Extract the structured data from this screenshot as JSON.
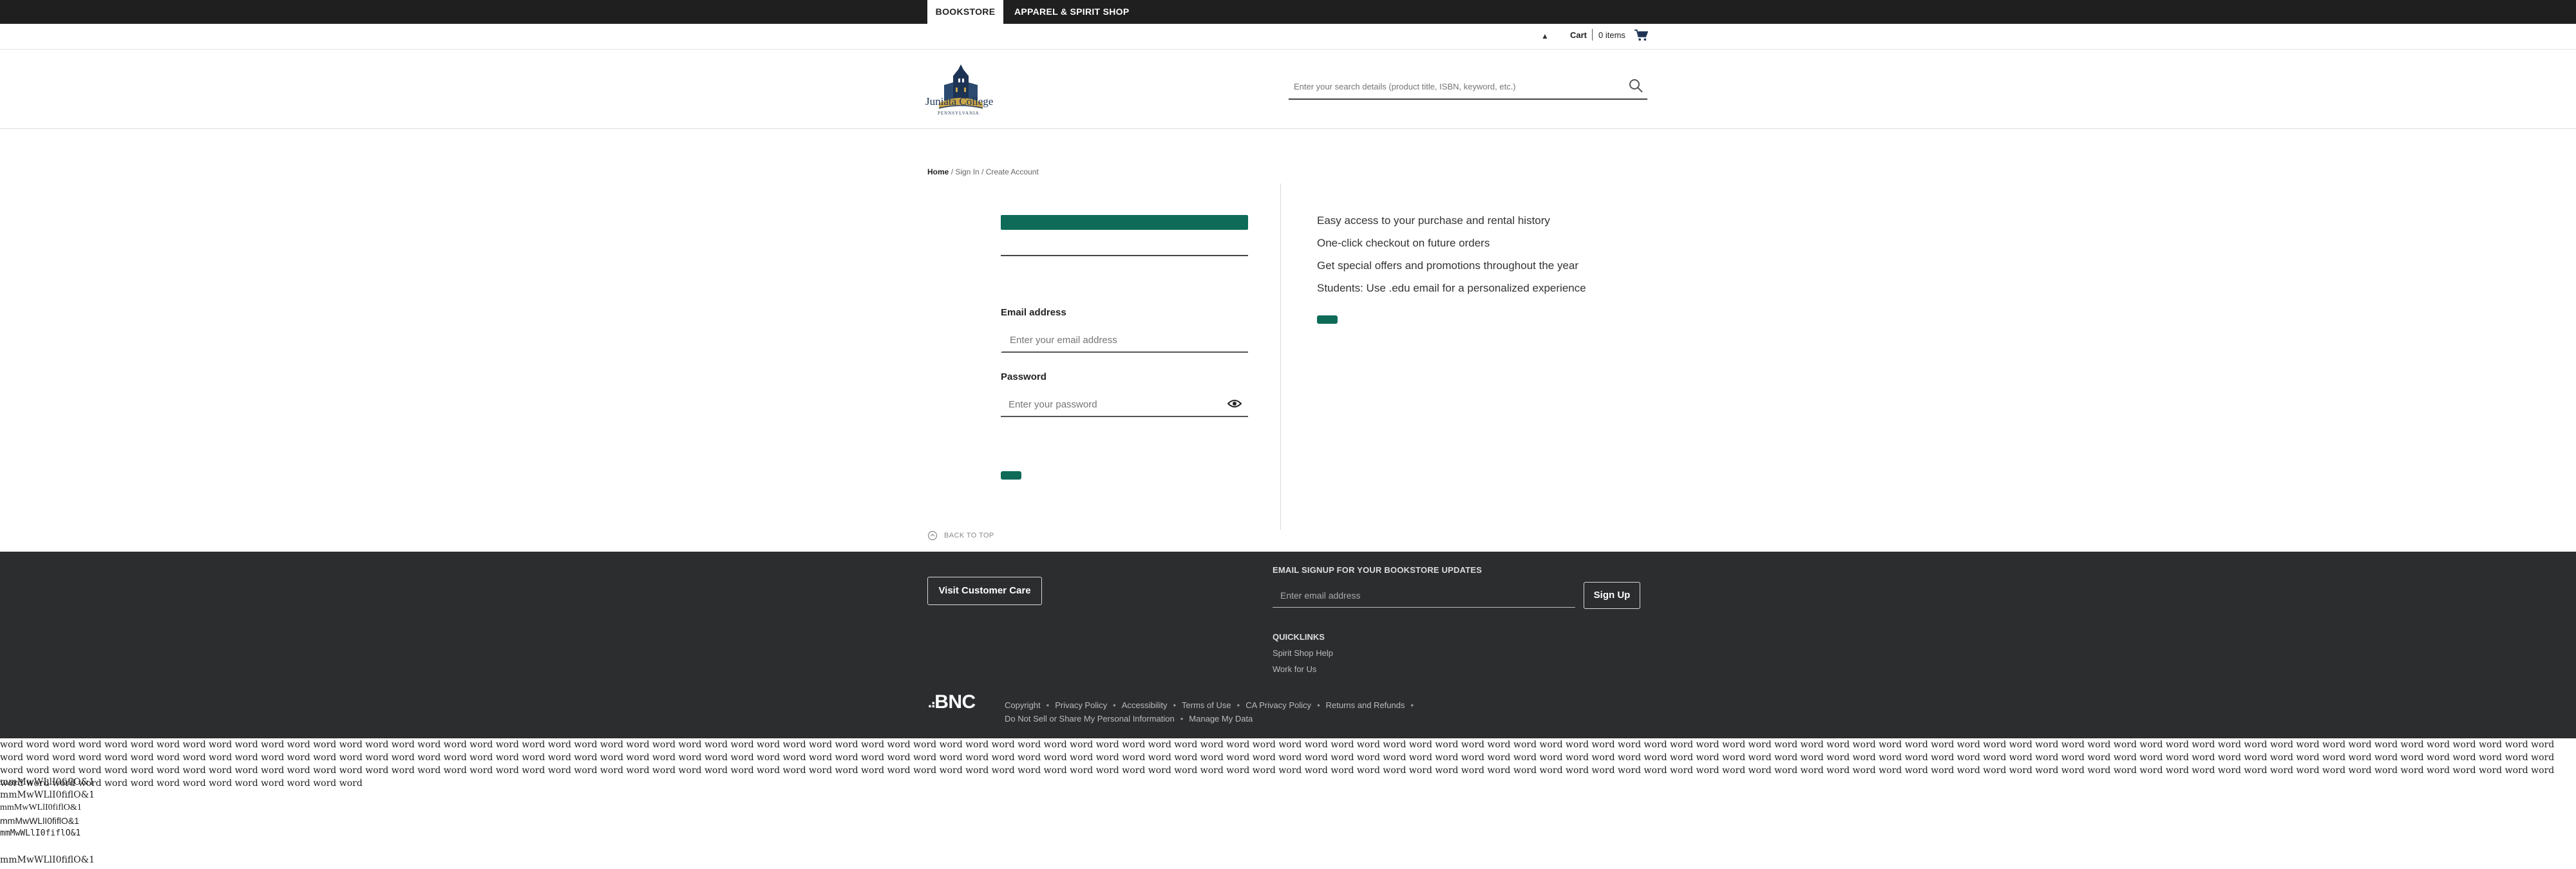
{
  "topbar": {
    "tabs": [
      {
        "label": "BOOKSTORE",
        "active": true
      },
      {
        "label": "APPAREL & SPIRIT SHOP",
        "active": false
      }
    ]
  },
  "utility": {
    "cart_label": "Cart",
    "cart_count": "0 items"
  },
  "header": {
    "logo_name": "Juniata College",
    "logo_sub": "PENNSYLVANIA",
    "search_placeholder": "Enter your search details (product title, ISBN, keyword, etc.)"
  },
  "breadcrumb": {
    "home": "Home",
    "separator": "/",
    "current": "Sign In / Create Account"
  },
  "form": {
    "email_label": "Email address",
    "email_placeholder": "Enter your email address",
    "password_label": "Password",
    "password_placeholder": "Enter your password"
  },
  "benefits": [
    "Easy access to your purchase and rental history",
    "One-click checkout on future orders",
    "Get special offers and promotions throughout the year",
    "Students: Use .edu email for a personalized experience"
  ],
  "back_to_top": "BACK TO TOP",
  "footer": {
    "care_button": "Visit Customer Care",
    "signup_title": "EMAIL SIGNUP FOR YOUR BOOKSTORE UPDATES",
    "signup_placeholder": "Enter email address",
    "signup_button": "Sign Up",
    "quicklinks_title": "QUICKLINKS",
    "quicklinks": [
      "Spirit Shop Help",
      "Work for Us"
    ],
    "brand": "BNC",
    "legal_row1": [
      "Copyright",
      "Privacy Policy",
      "Accessibility",
      "Terms of Use",
      "CA Privacy Policy",
      "Returns and Refunds"
    ],
    "legal_row2": [
      "Do Not Sell or Share My Personal Information",
      "Manage My Data"
    ]
  },
  "debug": {
    "words": "word word word word word word word word word word word word word word word word word word word word word word word word word word word word word word word word word word word word word word word word word word word word word word word word word word word word word word word word word word word word word word word word word word word word word word word word word word word word word word word word word word word word word word word word word word word word word word word word word word word word word word word word word word word word word word word word word word word word word word word word word word word word word word word word word word word word word word word word word word word word word word word word word word word word word word word word word word word word word word word word word word word word word word word word word word word word word word word word word word word word word word word word word word word word word word word word word word word word word word word word word word word word word word word word word word word word word word word word word word word word word word word word word word word word word word word word word word word word word word word word word word word word word word word word word word word word word word word word word word word word word word word word word word word word word word word word word word word word word word word word word word word word word word word word word word word word word word word word word word word word word word word word word word word word",
    "glyph_lines": [
      "mmMwWLlI0fiflO&1",
      "mmMwWLlI0fiflO&1",
      "mmMwWLlI0fiflO&1",
      "mmMwWLlI0fiflO&1",
      "mmMwWLlI0fiflO&1",
      "mmMwWLlI0fiflO&1"
    ]
  },
  "colors": {
    "brand_green": "#0d6b58",
    "topbar": "#1f1f1f",
    "footer": "#2b2d2f"
  }
}
